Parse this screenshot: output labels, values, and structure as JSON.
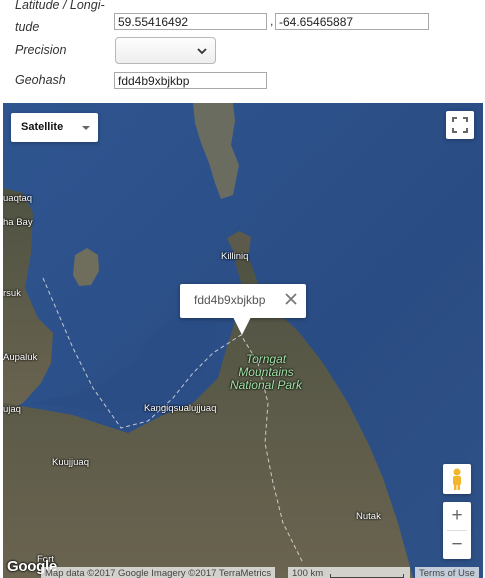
{
  "form": {
    "latlng_label_line1": "Latitude / Longi-",
    "latlng_label_line2": "tude",
    "latitude_value": "59.55416492",
    "separator": ",",
    "longitude_value": "-64.65465887",
    "precision_label": "Precision",
    "precision_value": "",
    "geohash_label": "Geohash",
    "geohash_value": "fdd4b9xbjkbp"
  },
  "map": {
    "map_type": "Satellite",
    "info_window_text": "fdd4b9xbjkbp",
    "places": {
      "uaqtaq": "uaqtaq",
      "ha_bay": "ha Bay",
      "killiniq": "Killiniq",
      "rsuk": "rsuk",
      "aupaluk": "Aupaluk",
      "ujaq": "ujaq",
      "kangiqsualujjuaq": "Kangiqsualujjuaq",
      "kuujjuaq": "Kuujjuaq",
      "nutak": "Nutak",
      "fort": "Fort"
    },
    "park_line1": "Torngat",
    "park_line2": "Mountains",
    "park_line3": "National Park",
    "logo": "Google",
    "attribution": "Map data ©2017 Google Imagery ©2017 TerraMetrics",
    "scale_label": "100 km",
    "terms": "Terms of Use",
    "zoom_in": "+",
    "zoom_out": "−"
  },
  "colors": {
    "ocean": "#2c4f86",
    "land": "#5d5a45",
    "park_label": "#9fe2a6"
  }
}
